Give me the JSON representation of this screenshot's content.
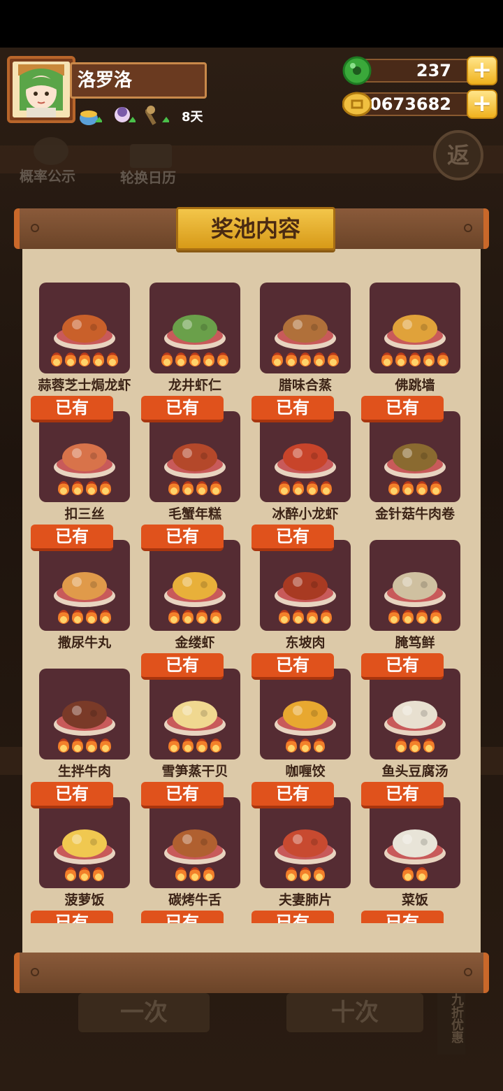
{
  "player": {
    "name": "洛罗洛",
    "days": "8天"
  },
  "currency": {
    "jade": "237",
    "coins": "40673682",
    "plus": "+"
  },
  "header_dim": {
    "probability": "概率公示",
    "calendar": "轮换日历",
    "return": "返"
  },
  "panel": {
    "title": "奖池内容",
    "owned_label": "已有"
  },
  "dishes": [
    {
      "name": "蒜蓉芝士焗龙虾",
      "owned": false,
      "stars": 5,
      "plate": "#c9602a"
    },
    {
      "name": "龙井虾仁",
      "owned": false,
      "stars": 5,
      "plate": "#6aa04a"
    },
    {
      "name": "腊味合蒸",
      "owned": false,
      "stars": 5,
      "plate": "#b0703a"
    },
    {
      "name": "佛跳墙",
      "owned": false,
      "stars": 5,
      "plate": "#e0a23a"
    },
    {
      "name": "扣三丝",
      "owned": true,
      "stars": 4,
      "plate": "#d8734a"
    },
    {
      "name": "毛蟹年糕",
      "owned": true,
      "stars": 4,
      "plate": "#b4482a"
    },
    {
      "name": "冰醉小龙虾",
      "owned": true,
      "stars": 4,
      "plate": "#c8442a"
    },
    {
      "name": "金针菇牛肉卷",
      "owned": true,
      "stars": 4,
      "plate": "#8a6a30"
    },
    {
      "name": "撒尿牛丸",
      "owned": true,
      "stars": 4,
      "plate": "#e09a4a"
    },
    {
      "name": "金缕虾",
      "owned": true,
      "stars": 4,
      "plate": "#e8b03a"
    },
    {
      "name": "东坡肉",
      "owned": true,
      "stars": 4,
      "plate": "#a83a22"
    },
    {
      "name": "腌笃鲜",
      "owned": false,
      "stars": 4,
      "plate": "#cfc0a0"
    },
    {
      "name": "生拌牛肉",
      "owned": false,
      "stars": 4,
      "plate": "#7a3a28"
    },
    {
      "name": "雪笋蒸干贝",
      "owned": true,
      "stars": 4,
      "plate": "#f0d890"
    },
    {
      "name": "咖喱饺",
      "owned": true,
      "stars": 3,
      "plate": "#e8a830"
    },
    {
      "name": "鱼头豆腐汤",
      "owned": true,
      "stars": 3,
      "plate": "#e8e0d0"
    },
    {
      "name": "菠萝饭",
      "owned": true,
      "stars": 3,
      "plate": "#f0c850"
    },
    {
      "name": "碳烤牛舌",
      "owned": true,
      "stars": 3,
      "plate": "#b06030"
    },
    {
      "name": "夫妻肺片",
      "owned": true,
      "stars": 3,
      "plate": "#c84a30"
    },
    {
      "name": "菜饭",
      "owned": true,
      "stars": 2,
      "plate": "#e8e4d8"
    },
    {
      "name": "",
      "owned": true,
      "stars": 0,
      "plate": "#552c33"
    },
    {
      "name": "",
      "owned": true,
      "stars": 0,
      "plate": "#552c33"
    },
    {
      "name": "",
      "owned": true,
      "stars": 0,
      "plate": "#552c33"
    },
    {
      "name": "",
      "owned": true,
      "stars": 0,
      "plate": "#552c33"
    }
  ],
  "bottom_dim": {
    "single": "一次",
    "ten": "十次",
    "discount": "九折优惠"
  },
  "colors": {
    "owned_tag": "#e0521c",
    "card_bg": "#552c33",
    "panel_bg": "#dcc9a8"
  }
}
